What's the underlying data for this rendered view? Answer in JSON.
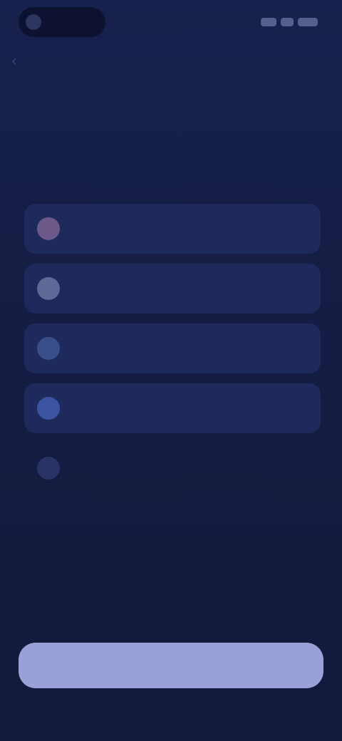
{
  "status_bar": {
    "icons": [
      "signal-icon",
      "wifi-icon",
      "battery-icon"
    ]
  },
  "header": {
    "back_icon": "chevron-left-icon",
    "title": "",
    "subtitle": ""
  },
  "options": [
    {
      "icon": "circle-icon",
      "icon_color": "#6e5a8a",
      "label": ""
    },
    {
      "icon": "circle-icon",
      "icon_color": "#5e6a96",
      "label": ""
    },
    {
      "icon": "circle-icon",
      "icon_color": "#3a4f8a",
      "label": ""
    },
    {
      "icon": "circle-icon",
      "icon_color": "#3c55a3",
      "label": ""
    },
    {
      "icon": "circle-icon",
      "icon_color": "#2a3366",
      "label": ""
    }
  ],
  "cta": {
    "label": ""
  },
  "colors": {
    "background": "#151c42",
    "option_bg": "#1e2a5c",
    "cta_bg": "#9aa1d8"
  }
}
